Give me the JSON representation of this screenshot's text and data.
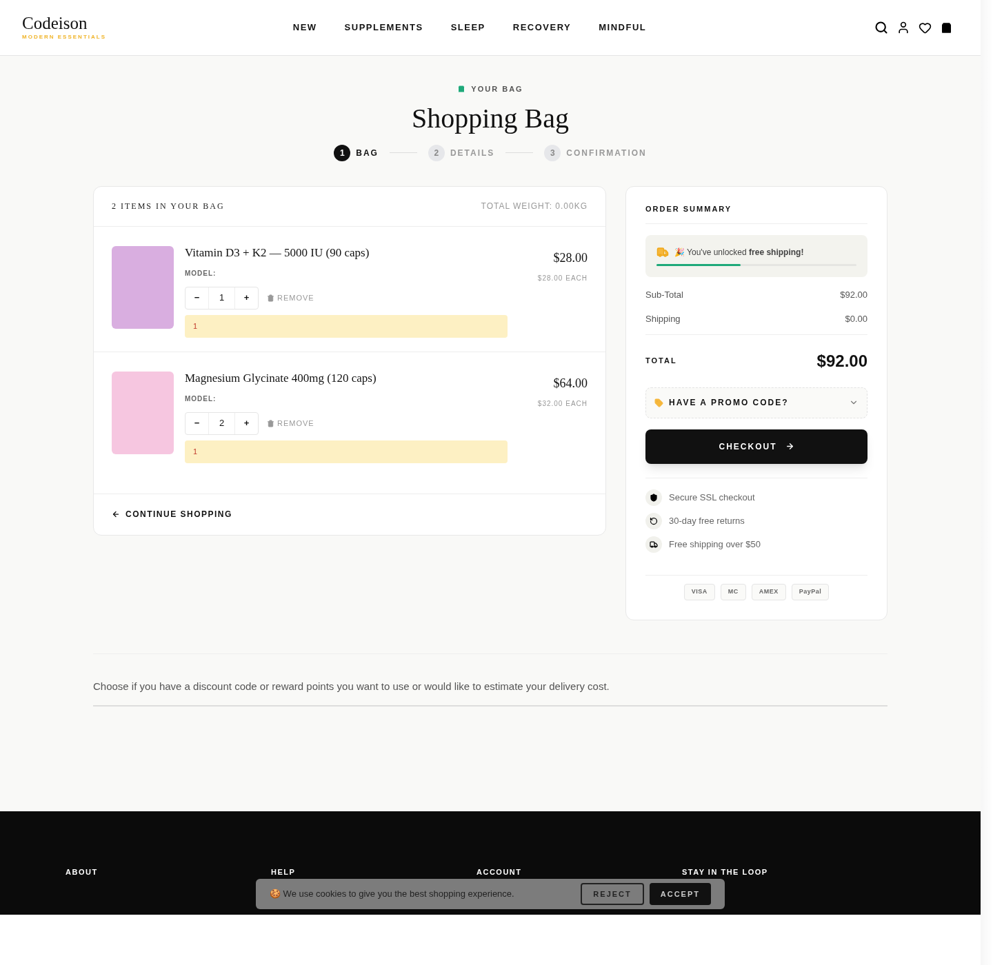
{
  "header": {
    "logo": {
      "name": "Codeison",
      "tagline": "MODERN ESSENTIALS"
    },
    "nav": [
      {
        "label": "NEW"
      },
      {
        "label": "SUPPLEMENTS"
      },
      {
        "label": "SLEEP"
      },
      {
        "label": "RECOVERY"
      },
      {
        "label": "MINDFUL"
      }
    ]
  },
  "page": {
    "eyebrow": "YOUR BAG",
    "title": "Shopping Bag",
    "steps": [
      {
        "number": "1",
        "label": "BAG",
        "selected": true
      },
      {
        "number": "2",
        "label": "DETAILS",
        "selected": false
      },
      {
        "number": "3",
        "label": "CONFIRMATION",
        "selected": false
      }
    ]
  },
  "bag": {
    "heading": "2 ITEMS IN YOUR BAG",
    "weight": "TOTAL WEIGHT: 0.00KG",
    "items": [
      {
        "name": "Vitamin D3 + K2 — 5000 IU (90 caps)",
        "model": "MODEL:",
        "quantity": "1",
        "remove": "REMOVE",
        "note": "1",
        "price": "$28.00",
        "each": "$28.00 EACH",
        "color": "#d9aee0"
      },
      {
        "name": "Magnesium Glycinate 400mg (120 caps)",
        "model": "MODEL:",
        "quantity": "2",
        "remove": "REMOVE",
        "note": "1",
        "price": "$64.00",
        "each": "$32.00 EACH",
        "color": "#f6c6e0"
      }
    ],
    "minus": "−",
    "plus": "+",
    "continue": "CONTINUE SHOPPING"
  },
  "summary": {
    "heading": "ORDER SUMMARY",
    "shipping_banner": {
      "text": "🎉 You've unlocked **free shipping!**",
      "level": 0.42
    },
    "rows": [
      {
        "label": "Sub-Total",
        "value": "$92.00"
      },
      {
        "label": "Shipping",
        "value": "$0.00"
      }
    ],
    "total": {
      "label": "TOTAL",
      "value": "$92.00"
    },
    "promo": {
      "label": "HAVE A PROMO CODE?",
      "expanded": false
    },
    "checkout": "CHECKOUT",
    "trust": [
      {
        "kind": "shield",
        "text": "Secure SSL checkout"
      },
      {
        "kind": "returns",
        "text": "30-day free returns"
      },
      {
        "kind": "truck",
        "text": "Free shipping over $50"
      }
    ],
    "payments": [
      "VISA",
      "MC",
      "AMEX",
      "PayPal"
    ]
  },
  "notice": "Choose if you have a discount code or reward points you want to use or would like to estimate your delivery cost.",
  "footer": {
    "columns": [
      "ABOUT",
      "HELP",
      "ACCOUNT",
      "STAY IN THE LOOP"
    ]
  },
  "cookie_banner": {
    "text": "🍪 We use cookies to give you the best shopping experience.",
    "buttons": [
      {
        "label": "REJECT",
        "kind": "outline"
      },
      {
        "label": "ACCEPT",
        "kind": "solid"
      }
    ]
  }
}
